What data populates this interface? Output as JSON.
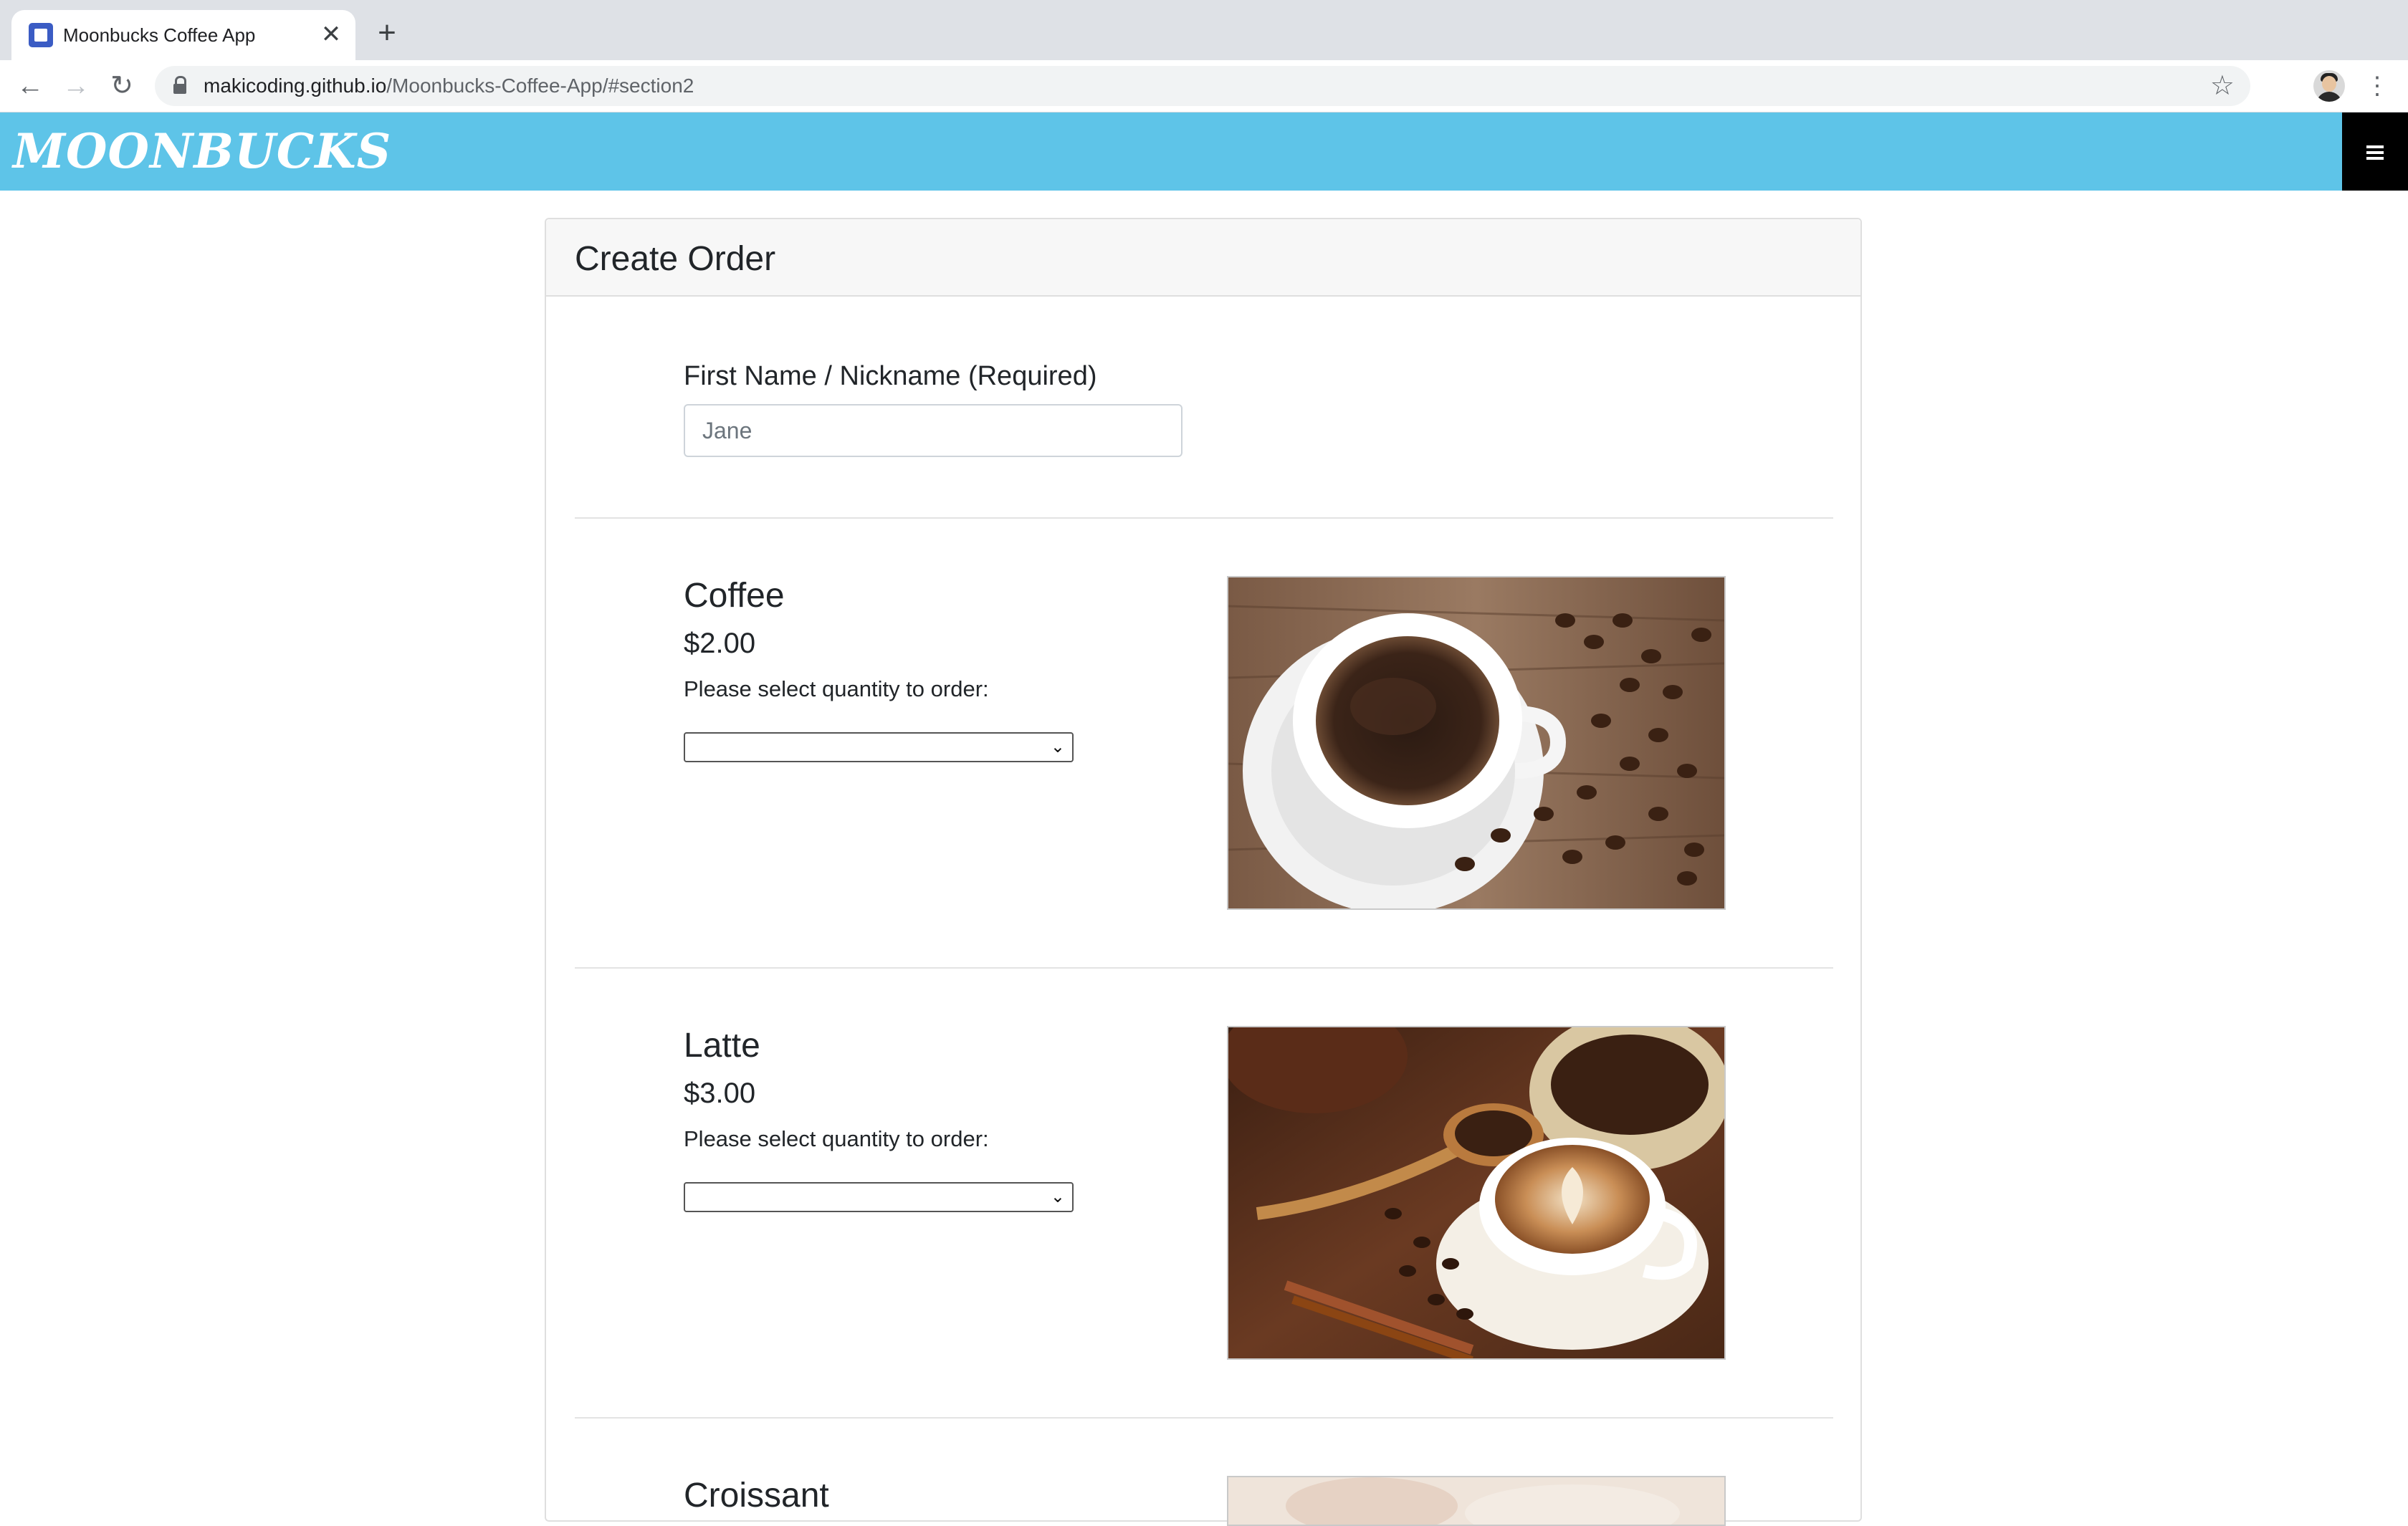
{
  "browser": {
    "tab_title": "Moonbucks Coffee App",
    "tab_close": "✕",
    "new_tab": "+",
    "back": "←",
    "forward": "→",
    "reload": "↻",
    "url_host": "makicoding.github.io",
    "url_path": "/Moonbucks-Coffee-App/#section2",
    "bookmark": "☆",
    "menu": "⋮",
    "icons": {
      "favicon": "square-logo-icon",
      "lock": "lock-icon",
      "profile": "profile-avatar"
    }
  },
  "site": {
    "brand": "MOONBUCKS",
    "header_color": "#5ec4e8",
    "menu_icon": "hamburger-menu-icon"
  },
  "order": {
    "title": "Create Order",
    "name_label": "First Name / Nickname (Required)",
    "name_placeholder": "Jane",
    "items": [
      {
        "name": "Coffee",
        "price": "$2.00",
        "prompt": "Please select quantity to order:",
        "quantity": "",
        "image": "coffee-cup-with-beans"
      },
      {
        "name": "Latte",
        "price": "$3.00",
        "prompt": "Please select quantity to order:",
        "quantity": "",
        "image": "latte-art-with-beans-and-cinnamon"
      },
      {
        "name": "Croissant",
        "image": "croissant"
      }
    ]
  }
}
